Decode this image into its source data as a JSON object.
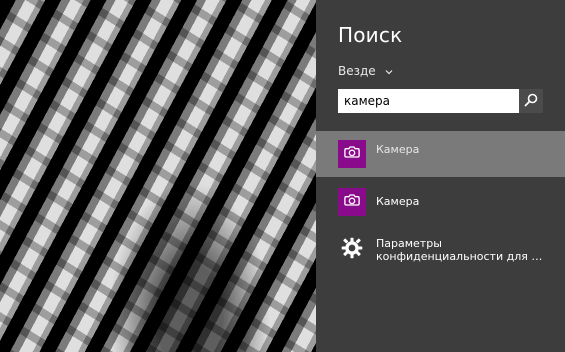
{
  "charm": {
    "title": "Поиск",
    "scope_label": "Везде",
    "search": {
      "value": "камера",
      "placeholder": ""
    },
    "results": [
      {
        "label": "Камера",
        "icon": "camera-icon",
        "tile_color": "#8a0a8c"
      },
      {
        "label": "Камера",
        "icon": "camera-icon",
        "tile_color": "#8a0a8c"
      },
      {
        "label_line1": "Параметры",
        "label_line2": "конфиденциальности для веб-...",
        "icon": "gear-icon"
      }
    ]
  },
  "colors": {
    "panel_bg": "#3d3d3d",
    "selection_bg": "#7a7a7a",
    "camera_tile": "#8a0a8c"
  }
}
